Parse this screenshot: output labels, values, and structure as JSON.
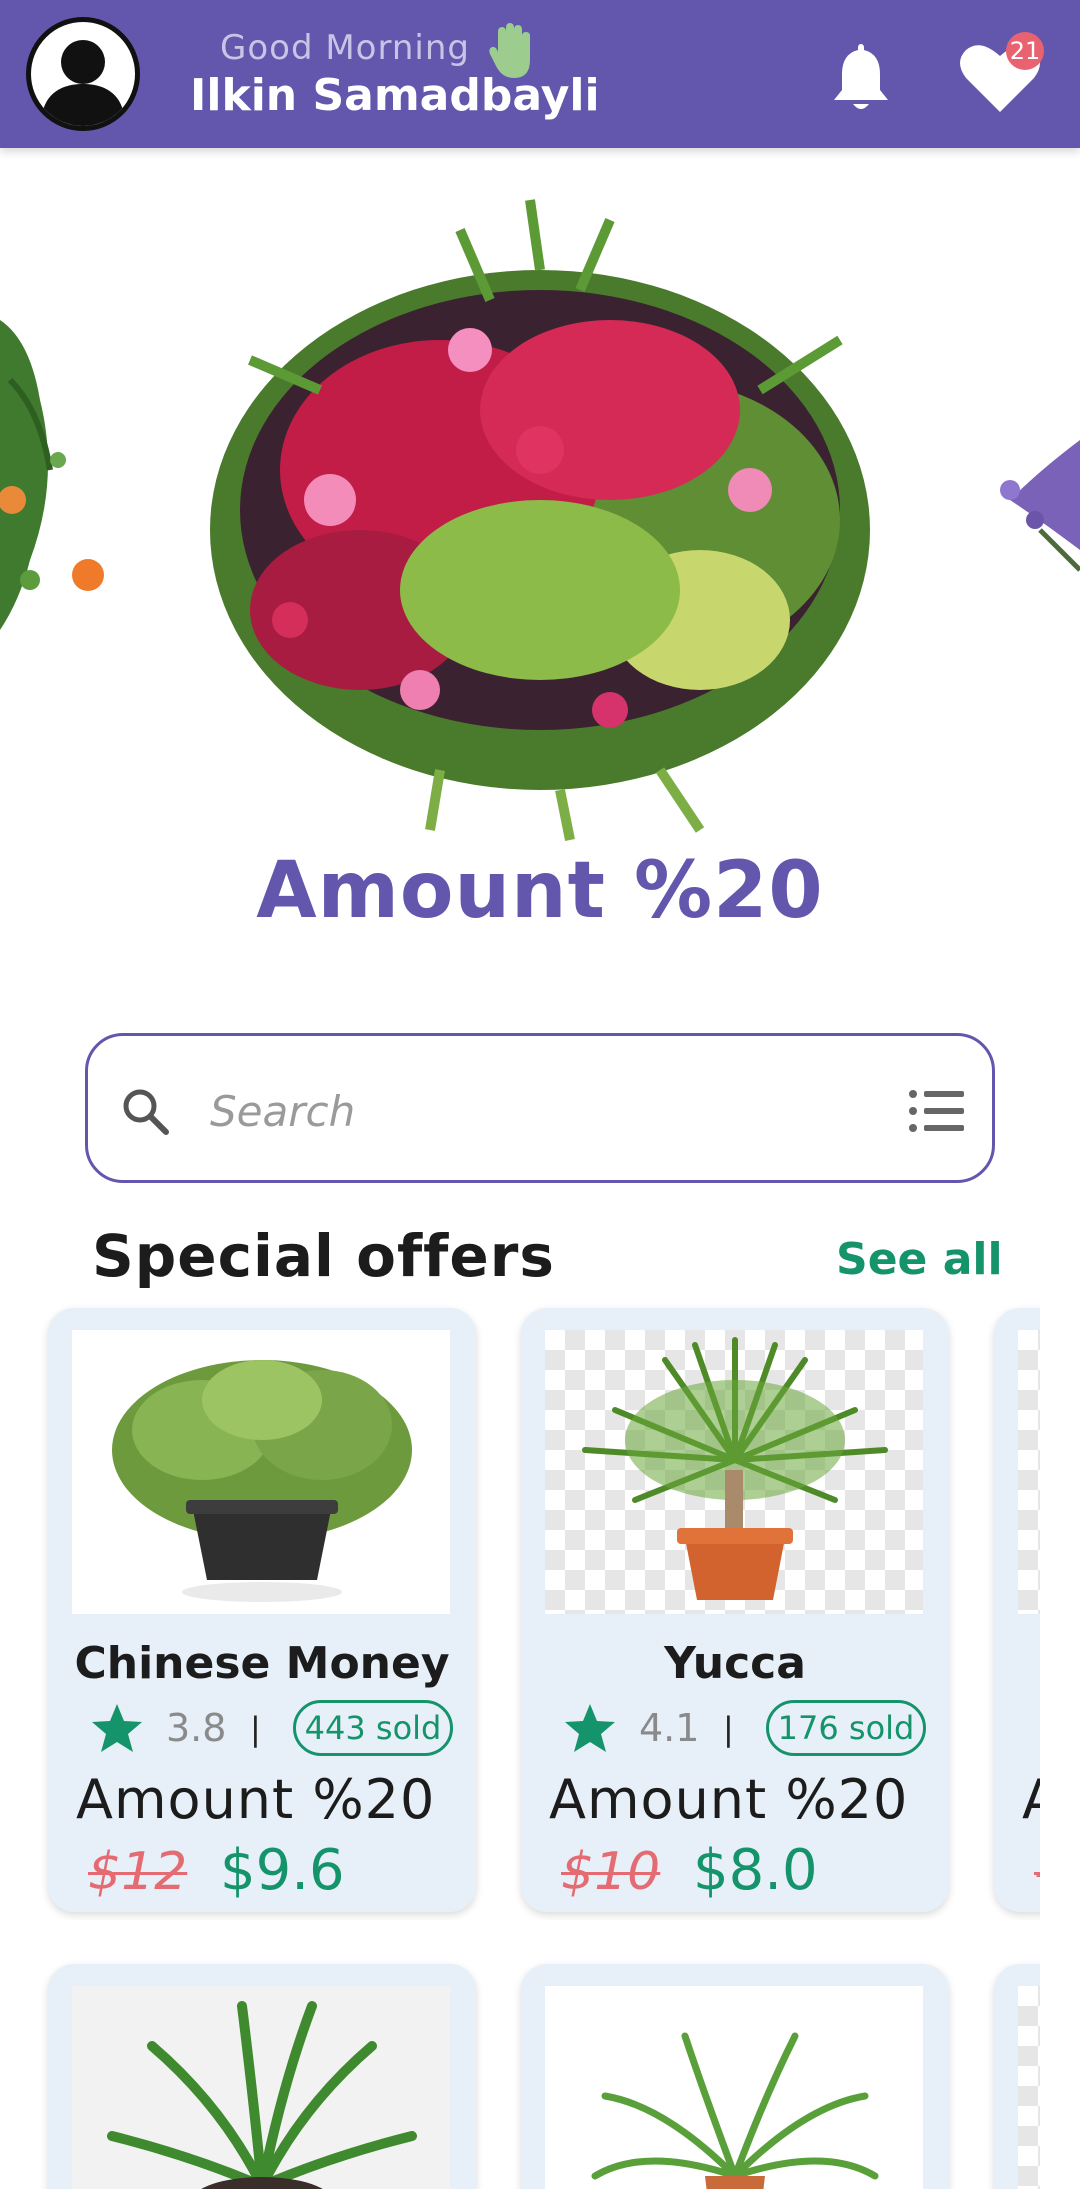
{
  "header": {
    "greeting": "Good Morning",
    "user_name": "Ilkin Samadbayli",
    "favorites_count": "21",
    "icons": [
      "avatar",
      "hand-wave-icon",
      "bell-icon",
      "heart-icon"
    ]
  },
  "banner": {
    "title": "Amount %20"
  },
  "search": {
    "placeholder": "Search"
  },
  "special_offers": {
    "title": "Special offers",
    "see_all": "See all",
    "cards": [
      {
        "name": "Chinese Money",
        "rating": "3.8",
        "separator": "|",
        "sold": "443 sold",
        "amount": "Amount %20",
        "old_price": "$12",
        "new_price": "$9.6"
      },
      {
        "name": "Yucca",
        "rating": "4.1",
        "separator": "|",
        "sold": "176 sold",
        "amount": "Amount %20",
        "old_price": "$10",
        "new_price": "$8.0"
      },
      {
        "name": "",
        "rating": "",
        "separator": "",
        "sold": "",
        "amount": "A",
        "old_price": "-",
        "new_price": ""
      }
    ]
  },
  "colors": {
    "primary": "#6256ad",
    "accent_green": "#15936a",
    "price_old": "#e46b72",
    "card_bg": "#e7f0f8",
    "badge": "#e8636f"
  }
}
